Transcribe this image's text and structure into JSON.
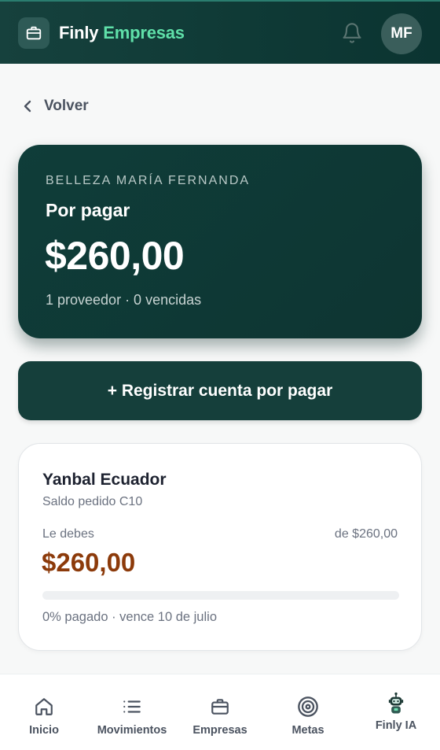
{
  "header": {
    "brand_primary": "Finly",
    "brand_accent": "Empresas",
    "avatar_initials": "MF",
    "accent_color": "#5fe0a9",
    "background_color": "#0f3a36"
  },
  "back": {
    "label": "Volver"
  },
  "summary": {
    "owner": "BELLEZA MARÍA FERNANDA",
    "label": "Por pagar",
    "amount": "$260,00",
    "meta": "1 proveedor · 0 vencidas"
  },
  "register_button": {
    "label": "+ Registrar cuenta por pagar"
  },
  "debt": {
    "vendor": "Yanbal Ecuador",
    "note": "Saldo pedido C10",
    "owe_label": "Le debes",
    "total": "de $260,00",
    "owe_amount": "$260,00",
    "progress_fraction": 0,
    "status": "0% pagado · vence 10 de julio",
    "amount_color": "#8c3a0a"
  },
  "nav": {
    "items": [
      {
        "label": "Inicio",
        "icon": "home-icon"
      },
      {
        "label": "Movimientos",
        "icon": "list-icon"
      },
      {
        "label": "Empresas",
        "icon": "briefcase-icon"
      },
      {
        "label": "Metas",
        "icon": "target-icon"
      },
      {
        "label": "Finly IA",
        "icon": "robot-icon"
      }
    ]
  }
}
